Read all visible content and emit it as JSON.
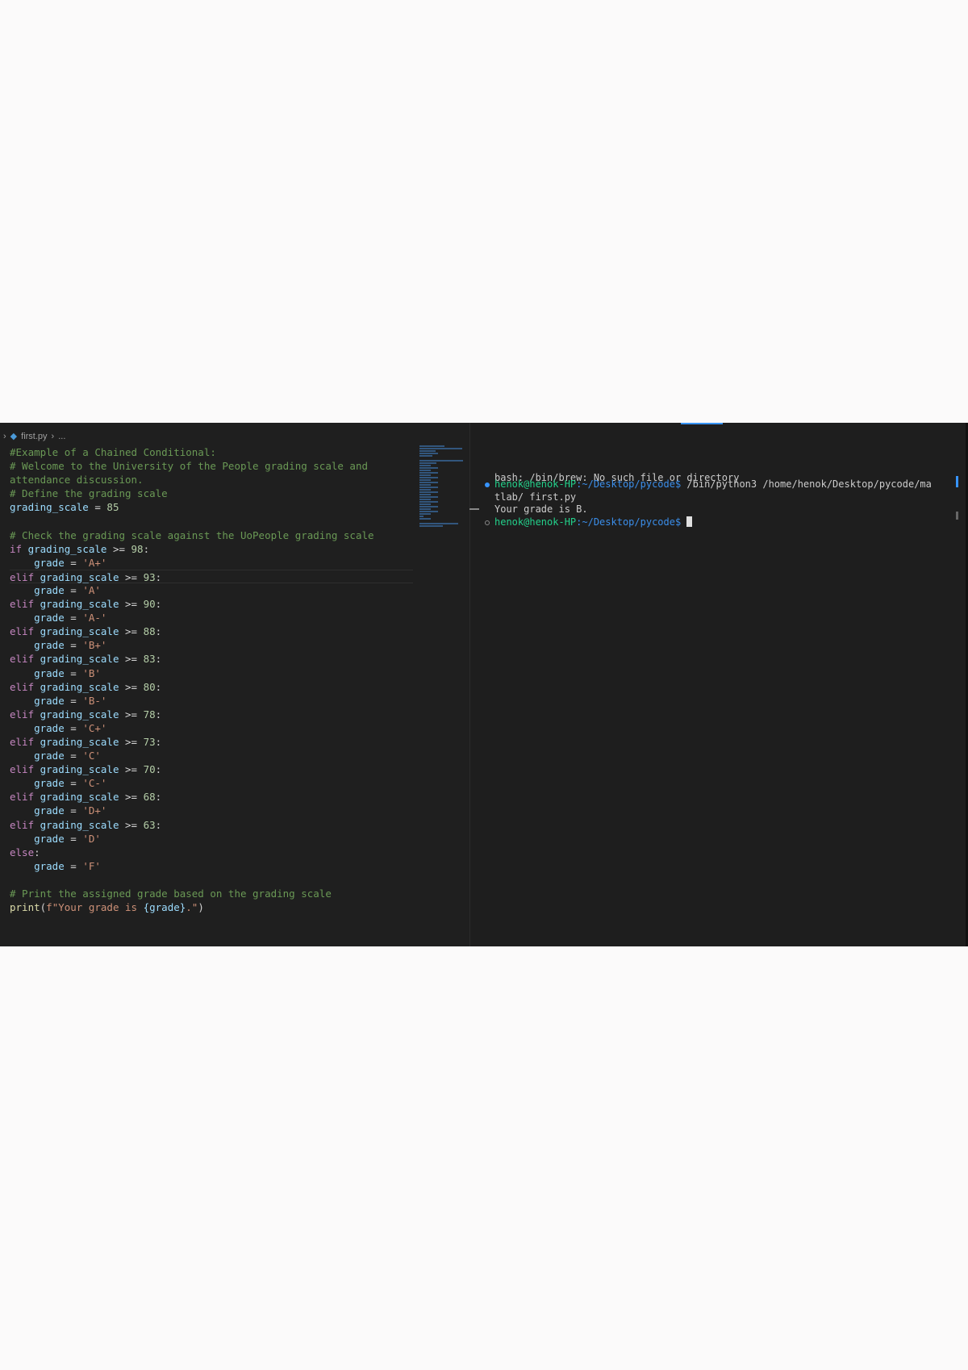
{
  "breadcrumb": {
    "file": "first.py",
    "rest": "..."
  },
  "code_lines": [
    [
      [
        "#Example of a Chained Conditional:",
        "c"
      ]
    ],
    [
      [
        "# Welcome to the University of the People grading scale and",
        "c"
      ]
    ],
    [
      [
        "attendance discussion.",
        "c"
      ]
    ],
    [
      [
        "# Define the grading scale",
        "c"
      ]
    ],
    [
      [
        "grading_scale",
        "v"
      ],
      [
        " = ",
        "o"
      ],
      [
        "85",
        "n"
      ]
    ],
    [],
    [
      [
        "# Check the grading scale against the UoPeople grading scale",
        "c"
      ]
    ],
    [
      [
        "if",
        "k"
      ],
      [
        " grading_scale",
        "v"
      ],
      [
        " >= ",
        "o"
      ],
      [
        "98",
        "n"
      ],
      [
        ":",
        "o"
      ]
    ],
    [
      [
        "    grade",
        "v"
      ],
      [
        " = ",
        "o"
      ],
      [
        "'A+'",
        "s"
      ]
    ],
    [
      [
        "elif",
        "k"
      ],
      [
        " grading_scale",
        "v"
      ],
      [
        " >= ",
        "o"
      ],
      [
        "93",
        "n"
      ],
      [
        ":",
        "o"
      ]
    ],
    [
      [
        "    grade",
        "v"
      ],
      [
        " = ",
        "o"
      ],
      [
        "'A'",
        "s"
      ]
    ],
    [
      [
        "elif",
        "k"
      ],
      [
        " grading_scale",
        "v"
      ],
      [
        " >= ",
        "o"
      ],
      [
        "90",
        "n"
      ],
      [
        ":",
        "o"
      ]
    ],
    [
      [
        "    grade",
        "v"
      ],
      [
        " = ",
        "o"
      ],
      [
        "'A-'",
        "s"
      ]
    ],
    [
      [
        "elif",
        "k"
      ],
      [
        " grading_scale",
        "v"
      ],
      [
        " >= ",
        "o"
      ],
      [
        "88",
        "n"
      ],
      [
        ":",
        "o"
      ]
    ],
    [
      [
        "    grade",
        "v"
      ],
      [
        " = ",
        "o"
      ],
      [
        "'B+'",
        "s"
      ]
    ],
    [
      [
        "elif",
        "k"
      ],
      [
        " grading_scale",
        "v"
      ],
      [
        " >= ",
        "o"
      ],
      [
        "83",
        "n"
      ],
      [
        ":",
        "o"
      ]
    ],
    [
      [
        "    grade",
        "v"
      ],
      [
        " = ",
        "o"
      ],
      [
        "'B'",
        "s"
      ]
    ],
    [
      [
        "elif",
        "k"
      ],
      [
        " grading_scale",
        "v"
      ],
      [
        " >= ",
        "o"
      ],
      [
        "80",
        "n"
      ],
      [
        ":",
        "o"
      ]
    ],
    [
      [
        "    grade",
        "v"
      ],
      [
        " = ",
        "o"
      ],
      [
        "'B-'",
        "s"
      ]
    ],
    [
      [
        "elif",
        "k"
      ],
      [
        " grading_scale",
        "v"
      ],
      [
        " >= ",
        "o"
      ],
      [
        "78",
        "n"
      ],
      [
        ":",
        "o"
      ]
    ],
    [
      [
        "    grade",
        "v"
      ],
      [
        " = ",
        "o"
      ],
      [
        "'C+'",
        "s"
      ]
    ],
    [
      [
        "elif",
        "k"
      ],
      [
        " grading_scale",
        "v"
      ],
      [
        " >= ",
        "o"
      ],
      [
        "73",
        "n"
      ],
      [
        ":",
        "o"
      ]
    ],
    [
      [
        "    grade",
        "v"
      ],
      [
        " = ",
        "o"
      ],
      [
        "'C'",
        "s"
      ]
    ],
    [
      [
        "elif",
        "k"
      ],
      [
        " grading_scale",
        "v"
      ],
      [
        " >= ",
        "o"
      ],
      [
        "70",
        "n"
      ],
      [
        ":",
        "o"
      ]
    ],
    [
      [
        "    grade",
        "v"
      ],
      [
        " = ",
        "o"
      ],
      [
        "'C-'",
        "s"
      ]
    ],
    [
      [
        "elif",
        "k"
      ],
      [
        " grading_scale",
        "v"
      ],
      [
        " >= ",
        "o"
      ],
      [
        "68",
        "n"
      ],
      [
        ":",
        "o"
      ]
    ],
    [
      [
        "    grade",
        "v"
      ],
      [
        " = ",
        "o"
      ],
      [
        "'D+'",
        "s"
      ]
    ],
    [
      [
        "elif",
        "k"
      ],
      [
        " grading_scale",
        "v"
      ],
      [
        " >= ",
        "o"
      ],
      [
        "63",
        "n"
      ],
      [
        ":",
        "o"
      ]
    ],
    [
      [
        "    grade",
        "v"
      ],
      [
        " = ",
        "o"
      ],
      [
        "'D'",
        "s"
      ]
    ],
    [
      [
        "else",
        "k"
      ],
      [
        ":",
        "o"
      ]
    ],
    [
      [
        "    grade",
        "v"
      ],
      [
        " = ",
        "o"
      ],
      [
        "'F'",
        "s"
      ]
    ],
    [],
    [
      [
        "# Print the assigned grade based on the grading scale",
        "c"
      ]
    ],
    [
      [
        "print",
        "f"
      ],
      [
        "(",
        "o"
      ],
      [
        "f\"Your grade is ",
        "s"
      ],
      [
        "{grade}",
        "v"
      ],
      [
        ".\"",
        "s"
      ],
      [
        ")",
        "o"
      ]
    ]
  ],
  "terminal": {
    "error": "bash: /bin/brew: No such file or directory",
    "prompt_user": "henok@henok-HP",
    "prompt_path": ":~/Desktop/pycode$",
    "command": " /bin/python3 /home/henok/Desktop/pycode/ma",
    "command_wrap": "tlab/ first.py",
    "output": "Your grade is B."
  },
  "colors": {
    "success_dot": "#3794ff",
    "idle_dot": "#888888"
  }
}
